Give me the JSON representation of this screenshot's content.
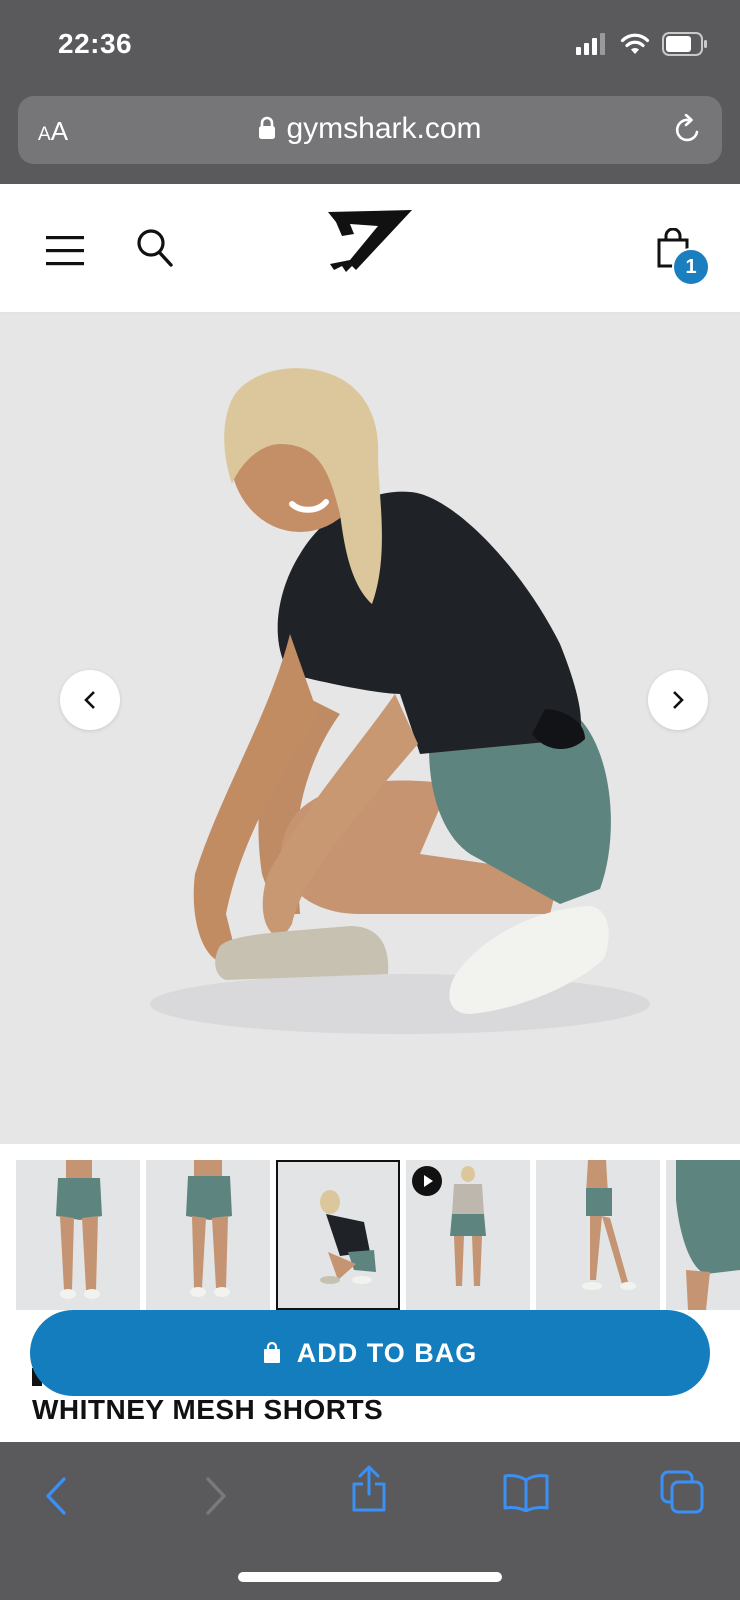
{
  "status_bar": {
    "time": "22:36"
  },
  "browser": {
    "aa_label_small": "A",
    "aa_label_large": "A",
    "url": "gymshark.com"
  },
  "header": {
    "cart_count": "1"
  },
  "product": {
    "title": "WHITNEY MESH SHORTS"
  },
  "cta": {
    "add_to_bag": "ADD TO BAG"
  },
  "colors": {
    "accent": "#137dbe",
    "chrome": "#5a5a5c",
    "shorts": "#5e8480",
    "tshirt": "#1f2226"
  }
}
